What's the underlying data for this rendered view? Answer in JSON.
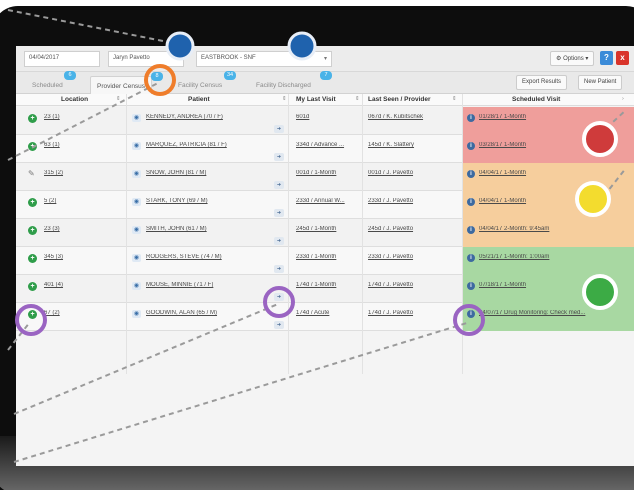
{
  "topbar": {
    "date": "04/04/2017",
    "provider": "Jaryn Pavetto",
    "facility": "EASTBROOK - SNF",
    "options_label": "Options",
    "help_label": "?",
    "close_label": "x"
  },
  "tabs": [
    {
      "label": "Scheduled",
      "badge": "6"
    },
    {
      "label": "Provider Census",
      "badge": "8"
    },
    {
      "label": "Facility Census",
      "badge": "34"
    },
    {
      "label": "Facility Discharged",
      "badge": "7"
    }
  ],
  "actions": {
    "export_label": "Export Results",
    "new_patient_label": "New Patient"
  },
  "columns": [
    "Location",
    "Patient",
    "My Last Visit",
    "Last Seen / Provider",
    "Scheduled Visit"
  ],
  "rows": [
    {
      "location": "23 (1)",
      "patient": "KENNEDY, ANDREA (70 / F)",
      "my_last_visit": "601d",
      "last_seen": "067d / K. Kubitschek",
      "scheduled": "01/28/17 1-Month",
      "status": "overdue",
      "icon": "plus"
    },
    {
      "location": "63 (1)",
      "patient": "MARQUEZ, PATRICIA (81 / F)",
      "my_last_visit": "334d / Advance ...",
      "last_seen": "145d / K. Slattery",
      "scheduled": "03/28/17 1-Month",
      "status": "overdue",
      "icon": "plus"
    },
    {
      "location": "315 (2)",
      "patient": "SNOW, JOHN (81 / M)",
      "my_last_visit": "001d / 1-Month",
      "last_seen": "001d / J. Pavetto",
      "scheduled": "04/04/17 1-Month",
      "status": "due",
      "icon": "edit"
    },
    {
      "location": "5 (2)",
      "patient": "STARK, TONY (69 / M)",
      "my_last_visit": "233d / Annual W...",
      "last_seen": "233d / J. Pavetto",
      "scheduled": "04/04/17 1-Month",
      "status": "due",
      "icon": "plus"
    },
    {
      "location": "23 (3)",
      "patient": "SMITH, JOHN (61 / M)",
      "my_last_visit": "245d / 1-Month",
      "last_seen": "245d / J. Pavetto",
      "scheduled": "04/04/17 2-Month: 9:45am",
      "status": "due",
      "icon": "plus"
    },
    {
      "location": "345 (3)",
      "patient": "RODGERS, STEVE (74 / M)",
      "my_last_visit": "233d / 1-Month",
      "last_seen": "233d / J. Pavetto",
      "scheduled": "05/21/17 1-Month: 1:00am",
      "status": "ok",
      "icon": "plus"
    },
    {
      "location": "401 (4)",
      "patient": "MOUSE, MINNIE (71 / F)",
      "my_last_visit": "174d / 1-Month",
      "last_seen": "174d / J. Pavetto",
      "scheduled": "07/18/17 1-Month",
      "status": "ok",
      "icon": "plus"
    },
    {
      "location": "67 (2)",
      "patient": "GOODWIN, ALAN (65 / M)",
      "my_last_visit": "174d / Acute",
      "last_seen": "174d / J. Pavetto",
      "scheduled": "04/07/17 Drug Monitoring: Check med...",
      "status": "ok",
      "icon": "plus"
    }
  ],
  "status_colors": {
    "overdue": "#ef9e9b",
    "due": "#f6ce9d",
    "ok": "#a8d8a2",
    "red_dot": "#cf3b3b",
    "yellow_dot": "#f3dc2e",
    "green_dot": "#3cab45",
    "blue_marker": "#1f62ad",
    "orange_ring": "#ef7d2b",
    "purple_ring": "#9a64c2"
  }
}
